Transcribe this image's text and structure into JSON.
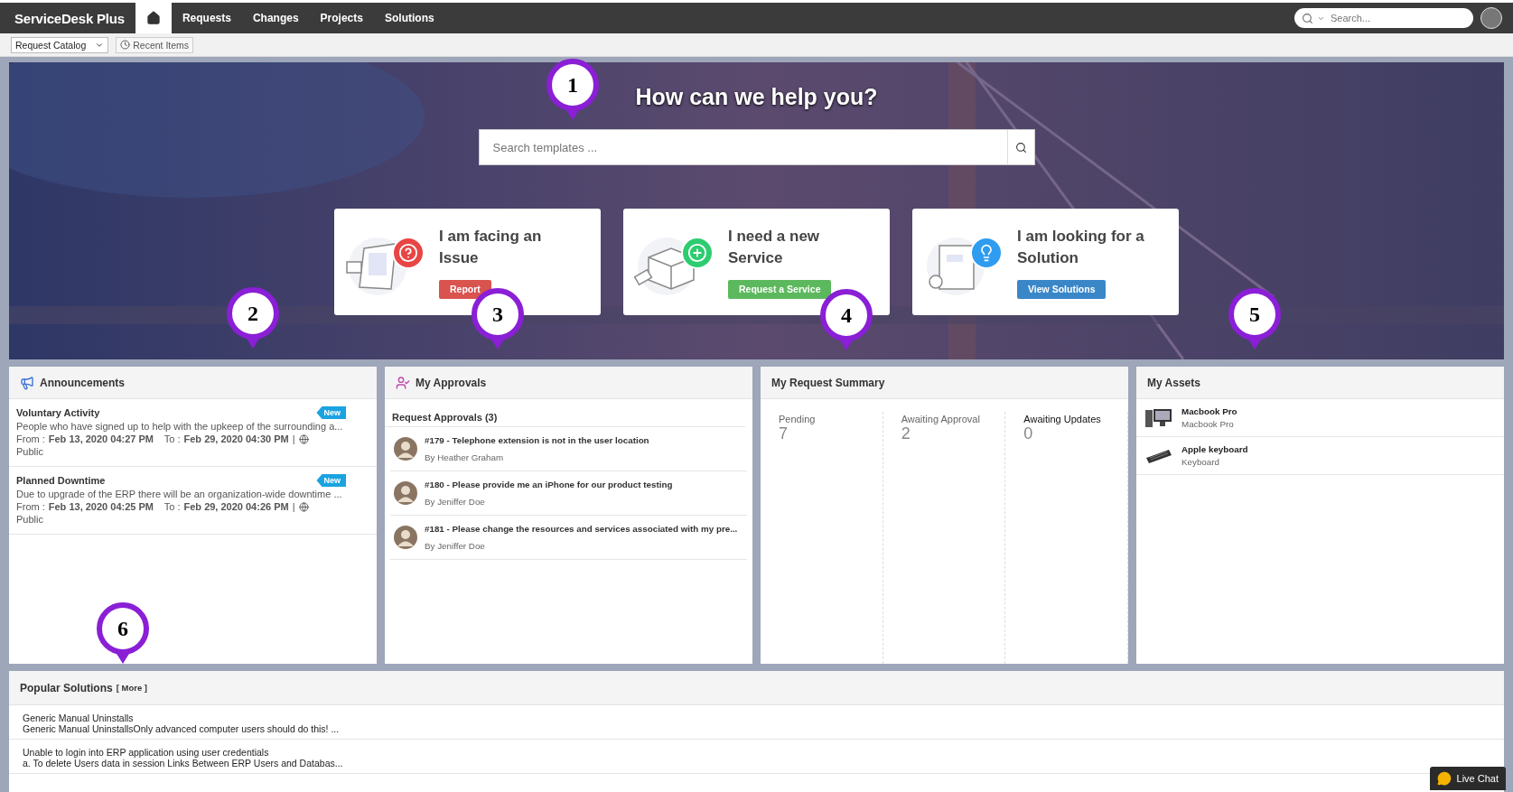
{
  "nav": {
    "logo": "ServiceDesk Plus",
    "items": [
      {
        "kind": "home",
        "selected": true
      },
      {
        "kind": "link",
        "label": "Requests",
        "selected": false
      },
      {
        "kind": "link",
        "label": "Changes",
        "selected": false
      },
      {
        "kind": "link",
        "label": "Projects",
        "selected": false
      },
      {
        "kind": "link",
        "label": "Solutions",
        "selected": false
      }
    ],
    "search": {
      "placeholder": "Search..."
    }
  },
  "subbar": {
    "catalog": "Request Catalog",
    "recent": "Recent Items"
  },
  "hero": {
    "title": "How can we help you?",
    "search": {
      "placeholder": "Search templates ..."
    },
    "cards": [
      {
        "kind": "issue",
        "title": "I am facing an Issue",
        "button": "Report",
        "color": "#d9534f"
      },
      {
        "kind": "service",
        "title": "I need a new Service",
        "button": "Request a Service",
        "color": "#5cb85c"
      },
      {
        "kind": "solution",
        "title": "I am looking for a Solution",
        "button": "View Solutions",
        "color": "#3a87c8"
      }
    ]
  },
  "announcements": {
    "title": "Announcements",
    "items": [
      {
        "title": "Voluntary Activity",
        "text": "People who have signed up to help with the upkeep of the surrounding a...",
        "badge": "New",
        "from_label": "From :",
        "from": "Feb 13, 2020 04:27 PM",
        "to_label": "To :",
        "to": "Feb 29, 2020 04:30 PM",
        "separator": "|",
        "visibility": "Public"
      },
      {
        "title": "Planned Downtime",
        "text": "Due to upgrade of the ERP there will be an organization-wide downtime ...",
        "badge": "New",
        "from_label": "From :",
        "from": "Feb 13, 2020 04:25 PM",
        "to_label": "To :",
        "to": "Feb 29, 2020 04:26 PM",
        "separator": "|",
        "visibility": "Public"
      }
    ]
  },
  "approvals": {
    "title": "My Approvals",
    "subtitle": "Request Approvals (3)",
    "items": [
      {
        "title": "#179 - Telephone extension is not in the user location",
        "by": "By Heather Graham"
      },
      {
        "title": "#180 - Please provide me an iPhone for our product testing",
        "by": "By Jeniffer Doe"
      },
      {
        "title": "#181 - Please change the resources and services associated with my pre...",
        "by": "By Jeniffer Doe"
      }
    ]
  },
  "summary": {
    "title": "My Request Summary",
    "columns": [
      {
        "label": "Pending",
        "value": "7",
        "selected": false
      },
      {
        "label": "Awaiting Approval",
        "value": "2",
        "selected": false
      },
      {
        "label": "Awaiting Updates",
        "value": "0",
        "selected": true
      }
    ]
  },
  "assets": {
    "title": "My Assets",
    "items": [
      {
        "kind": "desktop",
        "name": "Macbook Pro",
        "type": "Macbook Pro"
      },
      {
        "kind": "keyboard",
        "name": "Apple keyboard",
        "type": "Keyboard"
      }
    ]
  },
  "popular": {
    "title": "Popular Solutions",
    "more": "[ More ]",
    "items": [
      {
        "title": "Generic Manual Uninstalls",
        "text": "Generic Manual UninstallsOnly advanced computer users should do this! ..."
      },
      {
        "title": "Unable to login into ERP application using user credentials",
        "text": "a. To delete Users data in session Links Between ERP Users and Databas..."
      }
    ]
  },
  "live_chat": "Live Chat",
  "markers": [
    "1",
    "2",
    "3",
    "4",
    "5",
    "6"
  ]
}
